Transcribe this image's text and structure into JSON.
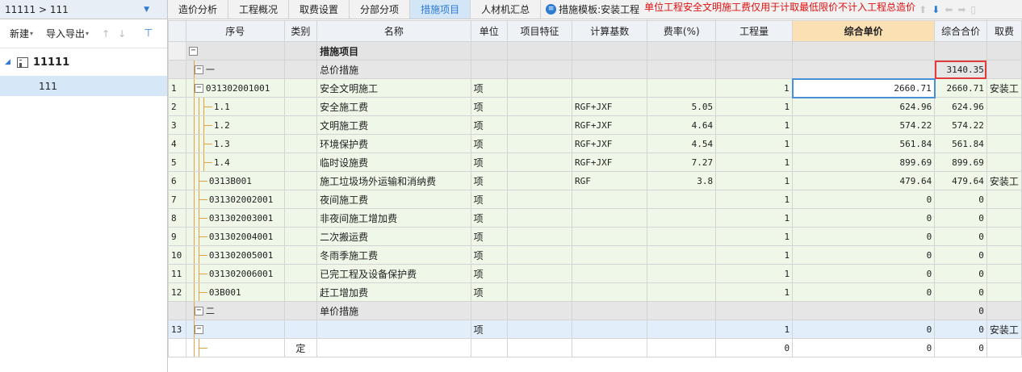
{
  "breadcrumb": "11111 > 111",
  "left_toolbar": {
    "new": "新建",
    "import_export": "导入导出"
  },
  "tree": {
    "root": "11111",
    "child": "111"
  },
  "tabs": [
    "造价分析",
    "工程概况",
    "取费设置",
    "分部分项",
    "措施项目",
    "人材机汇总"
  ],
  "active_tab": 4,
  "template_label": "措施模板:安装工程",
  "notice": "单位工程安全文明施工费仅用于计取最低限价不计入工程总造价",
  "columns": [
    "序号",
    "类别",
    "名称",
    "单位",
    "项目特征",
    "计算基数",
    "费率(%)",
    "工程量",
    "综合单价",
    "综合合价",
    "取费"
  ],
  "rows": [
    {
      "rn": "",
      "code": "",
      "cat": "",
      "name": "措施项目",
      "unit": "",
      "feat": "",
      "base": "",
      "rate": "",
      "qty": "",
      "price": "",
      "total": "",
      "fee": ""
    },
    {
      "rn": "",
      "code": "一",
      "cat": "",
      "name": "总价措施",
      "unit": "",
      "feat": "",
      "base": "",
      "rate": "",
      "qty": "",
      "price": "",
      "total": "3140.35",
      "fee": ""
    },
    {
      "rn": "1",
      "code": "031302001001",
      "cat": "",
      "name": "安全文明施工",
      "unit": "项",
      "feat": "",
      "base": "",
      "rate": "",
      "qty": "1",
      "price": "2660.71",
      "total": "2660.71",
      "fee": "安装工"
    },
    {
      "rn": "2",
      "code": "1.1",
      "cat": "",
      "name": "安全施工费",
      "unit": "项",
      "feat": "",
      "base": "RGF+JXF",
      "rate": "5.05",
      "qty": "1",
      "price": "624.96",
      "total": "624.96",
      "fee": ""
    },
    {
      "rn": "3",
      "code": "1.2",
      "cat": "",
      "name": "文明施工费",
      "unit": "项",
      "feat": "",
      "base": "RGF+JXF",
      "rate": "4.64",
      "qty": "1",
      "price": "574.22",
      "total": "574.22",
      "fee": ""
    },
    {
      "rn": "4",
      "code": "1.3",
      "cat": "",
      "name": "环境保护费",
      "unit": "项",
      "feat": "",
      "base": "RGF+JXF",
      "rate": "4.54",
      "qty": "1",
      "price": "561.84",
      "total": "561.84",
      "fee": ""
    },
    {
      "rn": "5",
      "code": "1.4",
      "cat": "",
      "name": "临时设施费",
      "unit": "项",
      "feat": "",
      "base": "RGF+JXF",
      "rate": "7.27",
      "qty": "1",
      "price": "899.69",
      "total": "899.69",
      "fee": ""
    },
    {
      "rn": "6",
      "code": "0313B001",
      "cat": "",
      "name": "施工垃圾场外运输和消纳费",
      "unit": "项",
      "feat": "",
      "base": "RGF",
      "rate": "3.8",
      "qty": "1",
      "price": "479.64",
      "total": "479.64",
      "fee": "安装工"
    },
    {
      "rn": "7",
      "code": "031302002001",
      "cat": "",
      "name": "夜间施工费",
      "unit": "项",
      "feat": "",
      "base": "",
      "rate": "",
      "qty": "1",
      "price": "0",
      "total": "0",
      "fee": ""
    },
    {
      "rn": "8",
      "code": "031302003001",
      "cat": "",
      "name": "非夜间施工增加费",
      "unit": "项",
      "feat": "",
      "base": "",
      "rate": "",
      "qty": "1",
      "price": "0",
      "total": "0",
      "fee": ""
    },
    {
      "rn": "9",
      "code": "031302004001",
      "cat": "",
      "name": "二次搬运费",
      "unit": "项",
      "feat": "",
      "base": "",
      "rate": "",
      "qty": "1",
      "price": "0",
      "total": "0",
      "fee": ""
    },
    {
      "rn": "10",
      "code": "031302005001",
      "cat": "",
      "name": "冬雨季施工费",
      "unit": "项",
      "feat": "",
      "base": "",
      "rate": "",
      "qty": "1",
      "price": "0",
      "total": "0",
      "fee": ""
    },
    {
      "rn": "11",
      "code": "031302006001",
      "cat": "",
      "name": "已完工程及设备保护费",
      "unit": "项",
      "feat": "",
      "base": "",
      "rate": "",
      "qty": "1",
      "price": "0",
      "total": "0",
      "fee": ""
    },
    {
      "rn": "12",
      "code": "03B001",
      "cat": "",
      "name": "赶工增加费",
      "unit": "项",
      "feat": "",
      "base": "",
      "rate": "",
      "qty": "1",
      "price": "0",
      "total": "0",
      "fee": ""
    },
    {
      "rn": "",
      "code": "二",
      "cat": "",
      "name": "单价措施",
      "unit": "",
      "feat": "",
      "base": "",
      "rate": "",
      "qty": "",
      "price": "",
      "total": "0",
      "fee": ""
    },
    {
      "rn": "13",
      "code": "",
      "cat": "",
      "name": "",
      "unit": "项",
      "feat": "",
      "base": "",
      "rate": "",
      "qty": "1",
      "price": "0",
      "total": "0",
      "fee": "安装工"
    },
    {
      "rn": "",
      "code": "",
      "cat": "定",
      "name": "",
      "unit": "",
      "feat": "",
      "base": "",
      "rate": "",
      "qty": "0",
      "price": "0",
      "total": "0",
      "fee": ""
    }
  ]
}
